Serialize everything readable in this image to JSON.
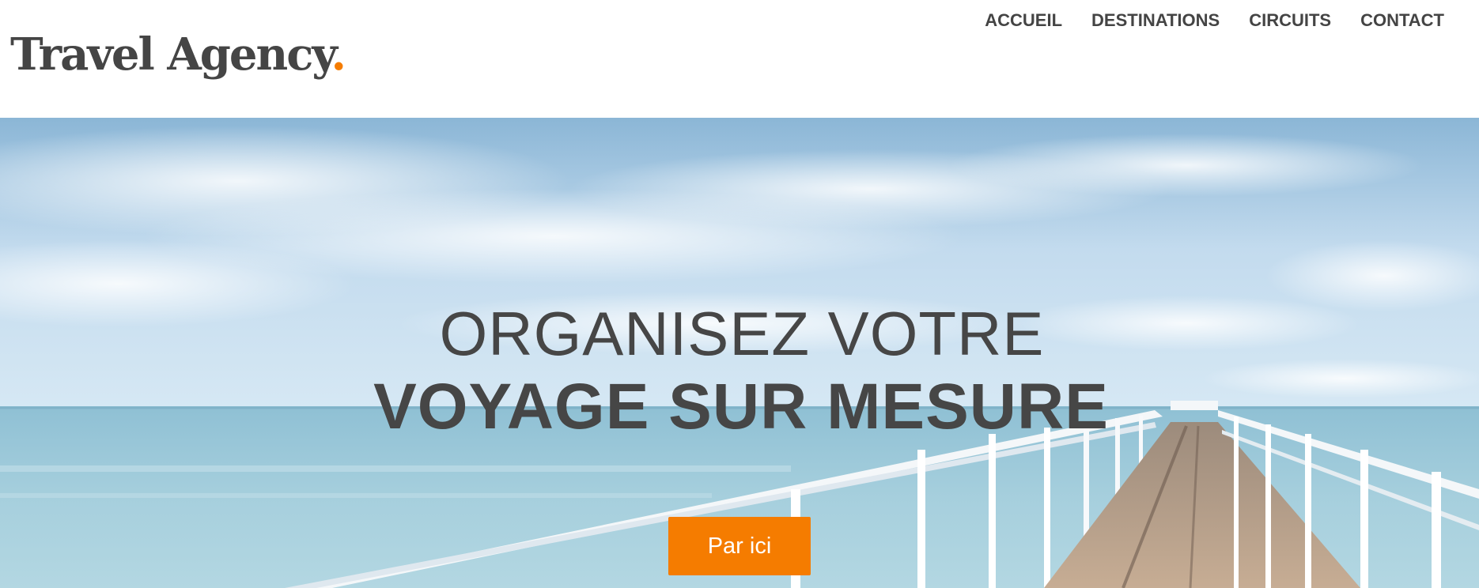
{
  "header": {
    "logo_text": "Travel Agency",
    "logo_dot": ".",
    "nav": [
      {
        "label": "ACCUEIL"
      },
      {
        "label": "DESTINATIONS"
      },
      {
        "label": "CIRCUITS"
      },
      {
        "label": "CONTACT"
      }
    ]
  },
  "hero": {
    "title_line1": "ORGANISEZ VOTRE",
    "title_line2": "VOYAGE SUR MESURE",
    "cta_label": "Par ici"
  },
  "colors": {
    "accent": "#f57c00",
    "text": "#464646",
    "background": "#ffffff"
  }
}
